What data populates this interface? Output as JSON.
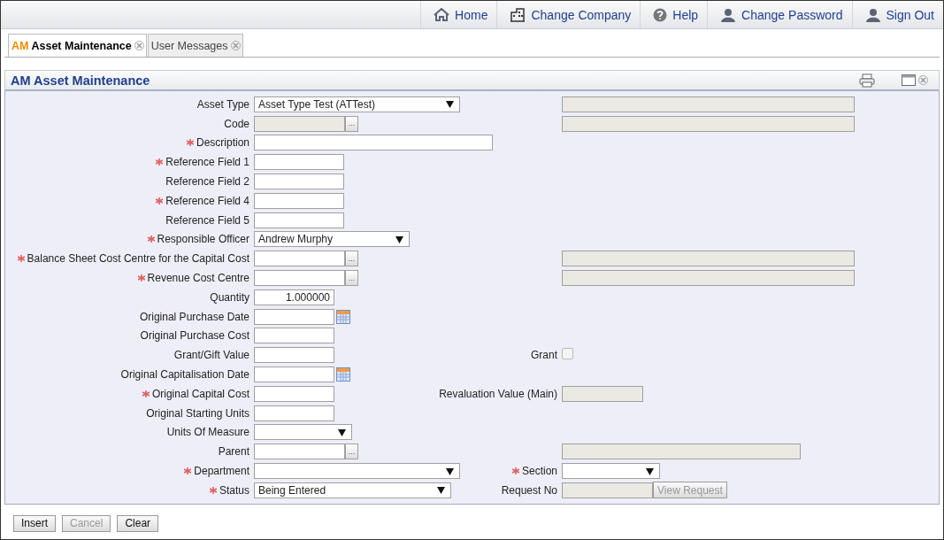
{
  "nav": [
    {
      "kind": "home",
      "label": "Home"
    },
    {
      "kind": "company",
      "label": "Change Company"
    },
    {
      "kind": "help",
      "label": "Help"
    },
    {
      "kind": "password",
      "label": "Change Password"
    },
    {
      "kind": "signout",
      "label": "Sign Out"
    }
  ],
  "tabs": [
    {
      "prefix": "AM",
      "label": "Asset Maintenance",
      "selected": true
    },
    {
      "label": "User Messages",
      "selected": false
    }
  ],
  "panel": {
    "title": "AM Asset Maintenance"
  },
  "rows": [
    {
      "label": "Asset Type",
      "required": false,
      "control": {
        "kind": "select",
        "value": "Asset Type Test (ATTest)"
      },
      "right": {
        "control": {
          "kind": "readonly"
        }
      }
    },
    {
      "label": "Code",
      "required": false,
      "control": {
        "kind": "lookup",
        "disabled": true,
        "button": "..."
      },
      "right": {
        "control": {
          "kind": "readonly"
        }
      }
    },
    {
      "label": "Description",
      "required": true,
      "control": {
        "kind": "text"
      }
    },
    {
      "label": "Reference Field 1",
      "required": true,
      "control": {
        "kind": "text"
      }
    },
    {
      "label": "Reference Field 2",
      "required": false,
      "control": {
        "kind": "text"
      }
    },
    {
      "label": "Reference Field 4",
      "required": true,
      "control": {
        "kind": "text"
      }
    },
    {
      "label": "Reference Field 5",
      "required": false,
      "control": {
        "kind": "text"
      }
    },
    {
      "label": "Responsible Officer",
      "required": true,
      "control": {
        "kind": "select",
        "value": "Andrew Murphy"
      }
    },
    {
      "label": "Balance Sheet Cost Centre for the Capital Cost",
      "required": true,
      "control": {
        "kind": "lookup",
        "disabled": false,
        "button": "..."
      },
      "right": {
        "control": {
          "kind": "readonly"
        }
      }
    },
    {
      "label": "Revenue Cost Centre",
      "required": true,
      "control": {
        "kind": "lookup",
        "disabled": false,
        "button": "..."
      },
      "right": {
        "control": {
          "kind": "readonly"
        }
      }
    },
    {
      "label": "Quantity",
      "required": false,
      "control": {
        "kind": "number",
        "value": "1.000000"
      }
    },
    {
      "label": "Original Purchase Date",
      "required": false,
      "control": {
        "kind": "date"
      }
    },
    {
      "label": "Original Purchase Cost",
      "required": false,
      "control": {
        "kind": "number"
      }
    },
    {
      "label": "Grant/Gift Value",
      "required": false,
      "control": {
        "kind": "number"
      },
      "right": {
        "label": "Grant",
        "required": false,
        "control": {
          "kind": "checkbox",
          "checked": false
        }
      }
    },
    {
      "label": "Original Capitalisation Date",
      "required": false,
      "control": {
        "kind": "date"
      }
    },
    {
      "label": "Original Capital Cost",
      "required": true,
      "control": {
        "kind": "number"
      },
      "right": {
        "label": "Revaluation Value (Main)",
        "required": false,
        "control": {
          "kind": "readonly"
        }
      }
    },
    {
      "label": "Original Starting Units",
      "required": false,
      "control": {
        "kind": "number"
      }
    },
    {
      "label": "Units Of Measure",
      "required": false,
      "control": {
        "kind": "select"
      }
    },
    {
      "label": "Parent",
      "required": false,
      "control": {
        "kind": "lookup",
        "disabled": false,
        "button": "..."
      },
      "right": {
        "control": {
          "kind": "readonly"
        }
      }
    },
    {
      "label": "Department",
      "required": true,
      "control": {
        "kind": "select"
      },
      "right": {
        "label": "Section",
        "required": true,
        "control": {
          "kind": "select"
        }
      }
    },
    {
      "label": "Status",
      "required": true,
      "control": {
        "kind": "select",
        "value": "Being Entered"
      },
      "right": {
        "label": "Request No",
        "required": false,
        "control": {
          "kind": "readonly-button",
          "button": "View Request",
          "disabled": true
        }
      }
    }
  ],
  "buttons": [
    {
      "label": "Insert",
      "disabled": false
    },
    {
      "label": "Cancel",
      "disabled": true
    },
    {
      "label": "Clear",
      "disabled": false
    }
  ]
}
